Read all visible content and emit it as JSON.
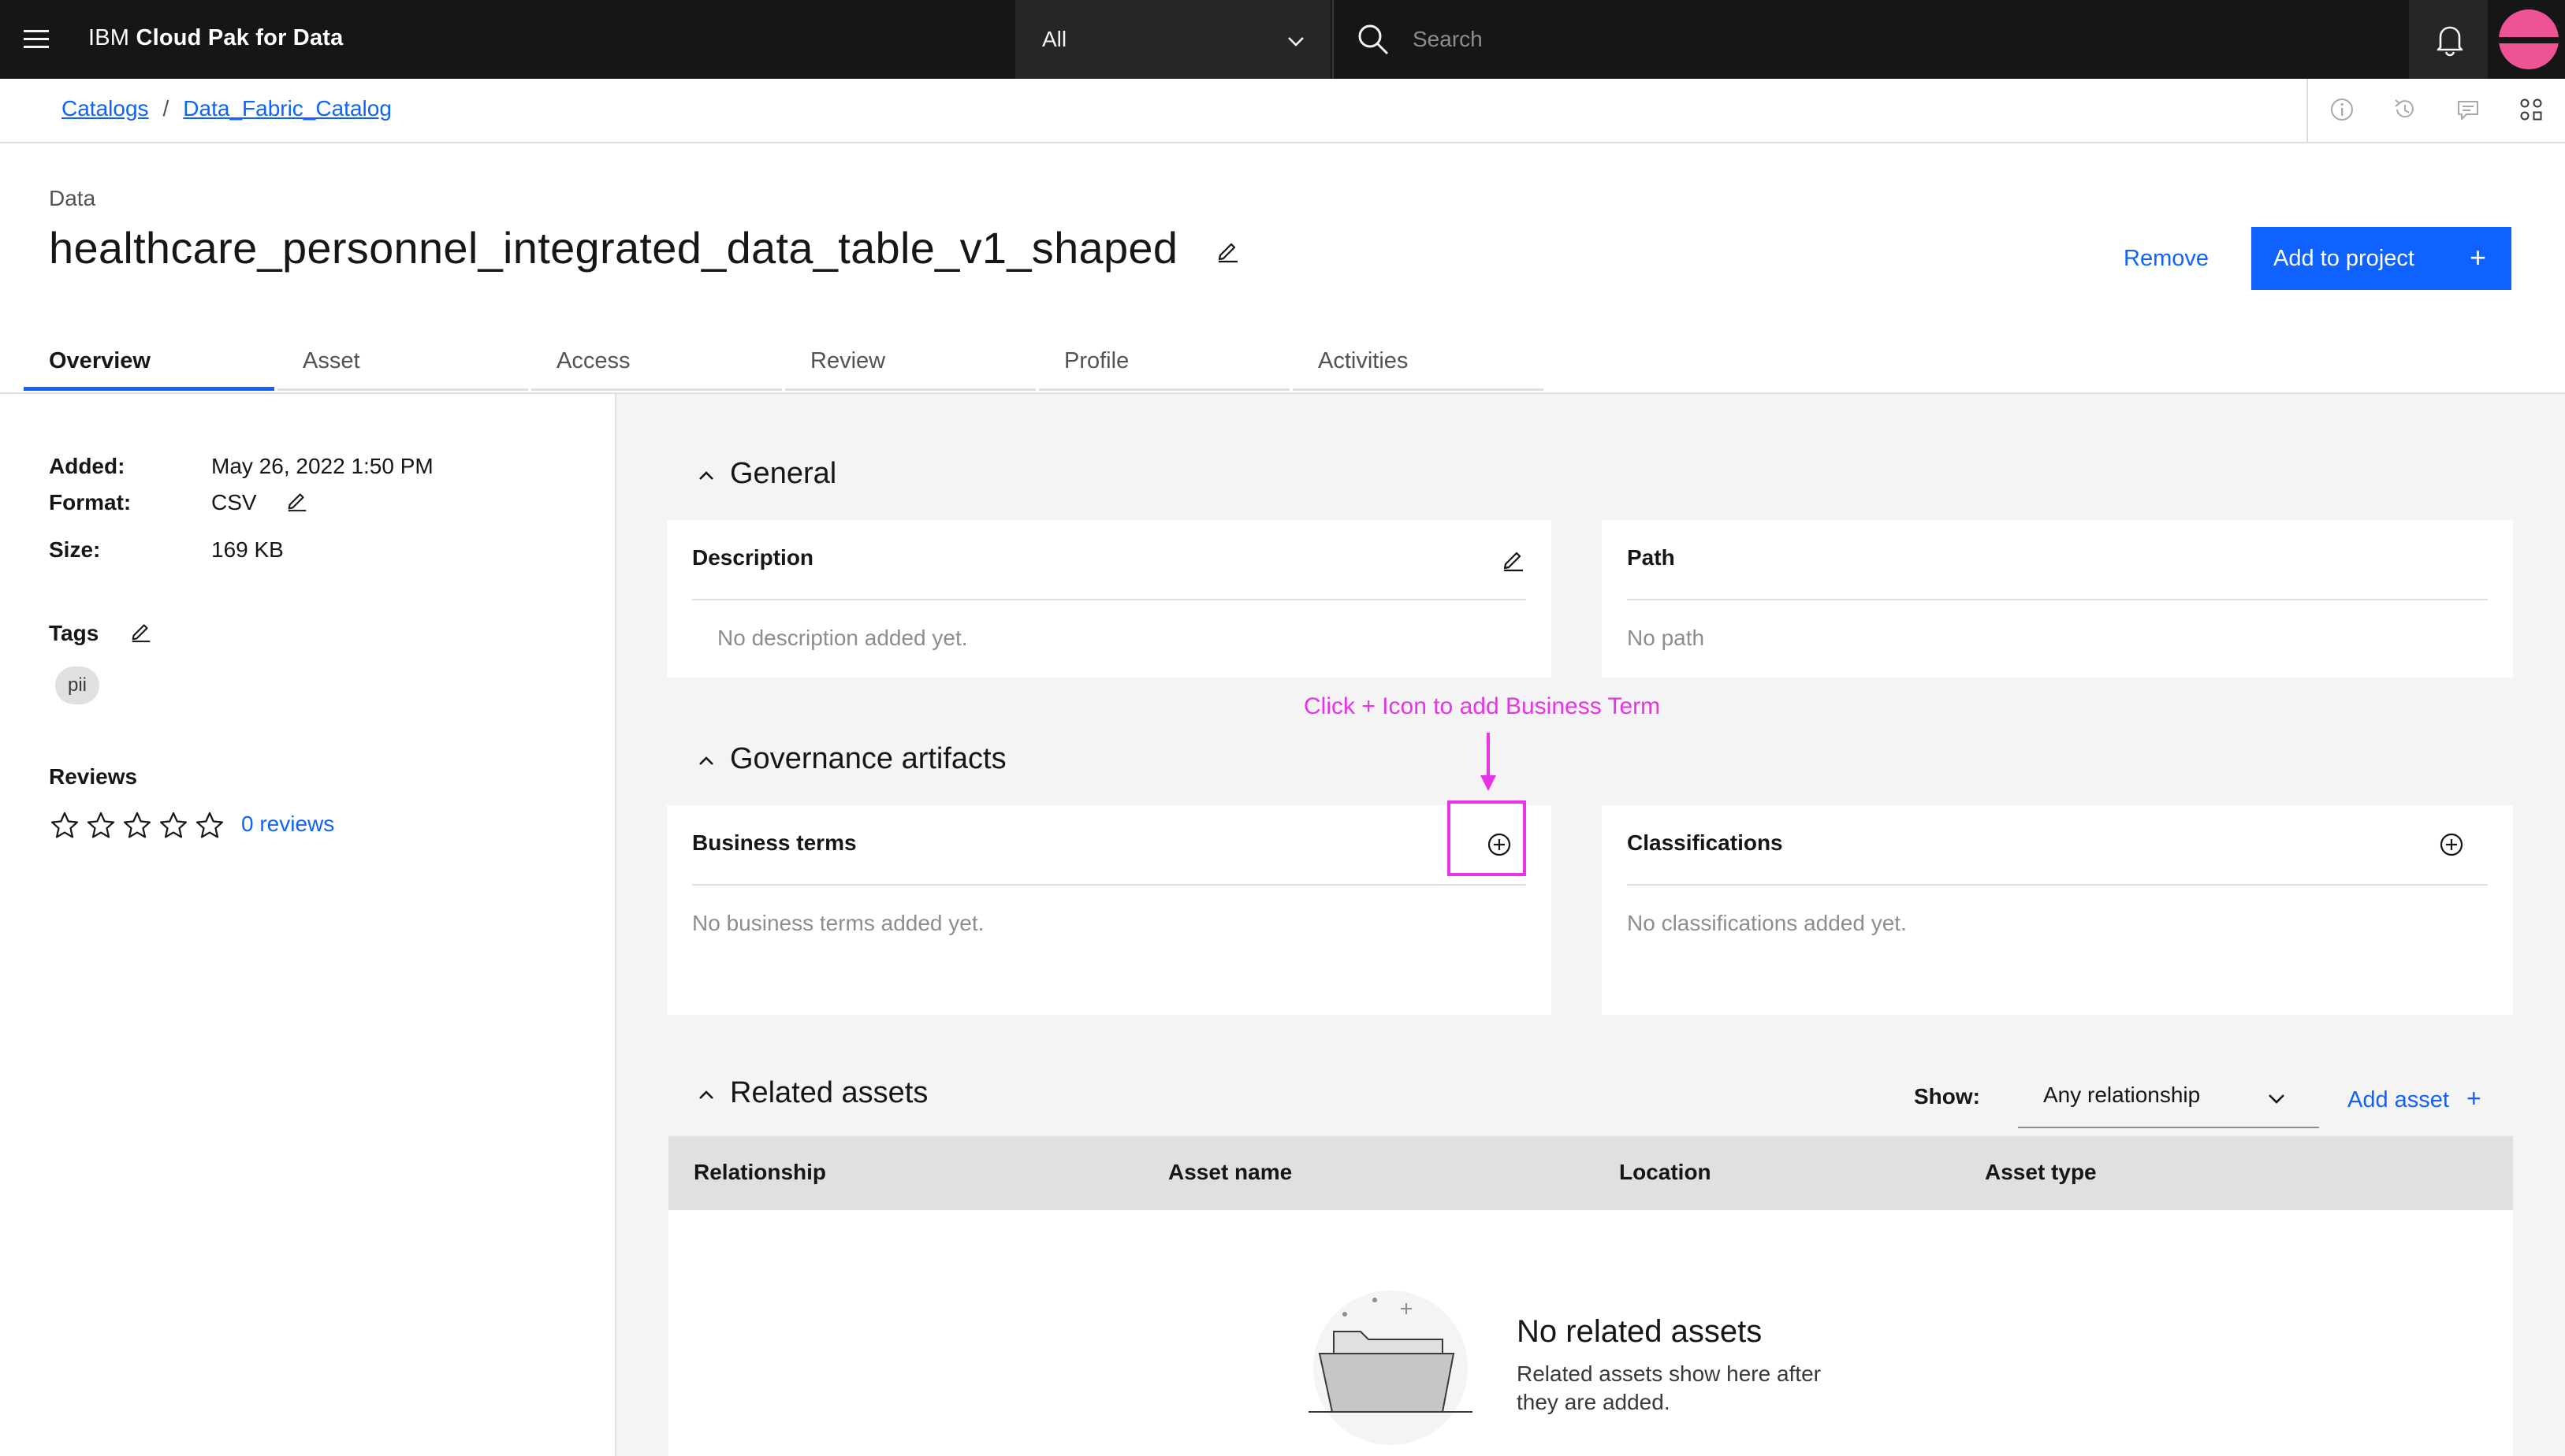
{
  "header": {
    "brand_prefix": "IBM",
    "brand_product": "Cloud Pak for Data",
    "scope_value": "All",
    "search_placeholder": "Search"
  },
  "breadcrumb": {
    "items": [
      "Catalogs",
      "Data_Fabric_Catalog"
    ],
    "separator": "/"
  },
  "asset": {
    "kicker": "Data",
    "title": "healthcare_personnel_integrated_data_table_v1_shaped"
  },
  "actions": {
    "remove_label": "Remove",
    "add_to_project_label": "Add to project",
    "plus": "+"
  },
  "tabs": [
    "Overview",
    "Asset",
    "Access",
    "Review",
    "Profile",
    "Activities"
  ],
  "active_tab": "Overview",
  "details": {
    "added_label": "Added:",
    "added_value": "May 26, 2022 1:50 PM",
    "format_label": "Format:",
    "format_value": "CSV",
    "size_label": "Size:",
    "size_value": "169 KB",
    "tags_heading": "Tags",
    "tags": [
      "pii"
    ],
    "reviews_heading": "Reviews",
    "rating": 0,
    "rating_max": 5,
    "reviews_link": "0 reviews"
  },
  "general": {
    "title": "General",
    "description_title": "Description",
    "description_empty": "No description added yet.",
    "path_title": "Path",
    "path_empty": "No path"
  },
  "governance": {
    "title": "Governance artifacts",
    "business_terms_title": "Business terms",
    "business_terms_empty": "No business terms added yet.",
    "classifications_title": "Classifications",
    "classifications_empty": "No classifications added yet."
  },
  "annotation": {
    "text": "Click + Icon to add Business Term",
    "color": "#e833e8"
  },
  "related": {
    "title": "Related assets",
    "show_label": "Show:",
    "filter_value": "Any relationship",
    "add_asset_label": "Add asset",
    "columns": [
      "Relationship",
      "Asset name",
      "Location",
      "Asset type"
    ],
    "empty_title": "No related assets",
    "empty_subtitle": "Related assets show here after they are added."
  },
  "colors": {
    "accent": "#0f62fe",
    "header_bg": "#161616",
    "avatar": "#ee5396"
  },
  "icons": {
    "menu": "hamburger-icon",
    "search": "search-icon",
    "notifications": "bell-icon",
    "edit": "pencil-icon",
    "add": "add-circle-icon",
    "collapse": "chevron-up-icon"
  }
}
